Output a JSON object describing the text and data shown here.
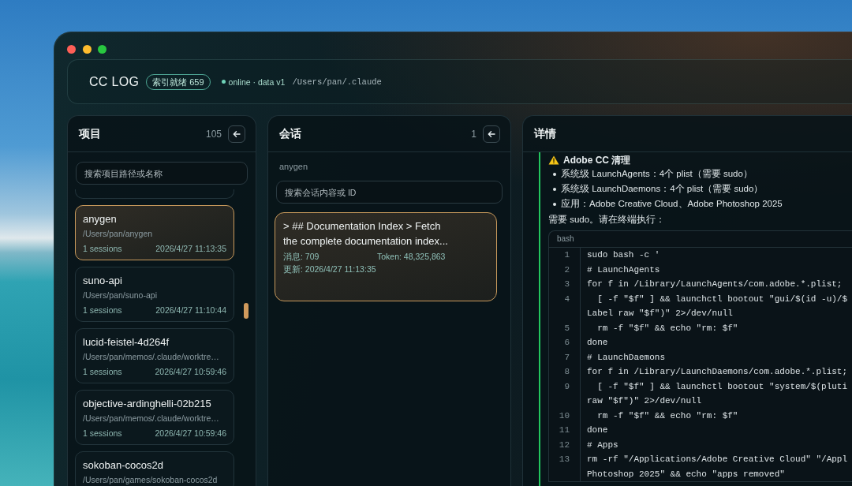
{
  "header": {
    "title": "CC LOG",
    "index_badge": "索引就绪 659",
    "status": "online · data v1",
    "path": "/Users/pan/.claude"
  },
  "projects_panel": {
    "title": "项目",
    "count": "105",
    "search": {
      "placeholder": "搜索项目路径或名称"
    },
    "items": [
      {
        "name": "anygen",
        "path": "/Users/pan/anygen",
        "sessions": "1 sessions",
        "updated": "2026/4/27 11:13:35",
        "selected": true
      },
      {
        "name": "suno-api",
        "path": "/Users/pan/suno-api",
        "sessions": "1 sessions",
        "updated": "2026/4/27 11:10:44",
        "selected": false
      },
      {
        "name": "lucid-feistel-4d264f",
        "path": "/Users/pan/memos/.claude/worktre…",
        "sessions": "1 sessions",
        "updated": "2026/4/27 10:59:46",
        "selected": false
      },
      {
        "name": "objective-ardinghelli-02b215",
        "path": "/Users/pan/memos/.claude/worktre…",
        "sessions": "1 sessions",
        "updated": "2026/4/27 10:59:46",
        "selected": false
      },
      {
        "name": "sokoban-cocos2d",
        "path": "/Users/pan/games/sokoban-cocos2d",
        "selected": false
      }
    ]
  },
  "sessions_panel": {
    "title": "会话",
    "count": "1",
    "project": "anygen",
    "search": {
      "placeholder": "搜索会话内容或 ID"
    },
    "items": [
      {
        "title": "> ## Documentation Index > Fetch the complete documentation index...",
        "messages": "消息: 709",
        "tokens": "Token: 48,325,863",
        "updated": "更新: 2026/4/27 11:13:35",
        "selected": true
      }
    ]
  },
  "details_panel": {
    "title": "详情",
    "message": {
      "heading": "Adobe CC 清理",
      "bullets": [
        "系统级 LaunchAgents：4个 plist（需要 sudo）",
        "系统级 LaunchDaemons：4个 plist（需要 sudo）",
        "应用：Adobe Creative Cloud、Adobe Photoshop 2025"
      ],
      "note": "需要 sudo。请在终端执行：",
      "code": {
        "language": "bash",
        "lines": [
          {
            "number": "1",
            "rows": [
              "sudo bash -c '"
            ]
          },
          {
            "number": "2",
            "rows": [
              "# LaunchAgents"
            ]
          },
          {
            "number": "3",
            "rows": [
              "for f in /Library/LaunchAgents/com.adobe.*.plist;"
            ]
          },
          {
            "number": "4",
            "rows": [
              "  [ -f \"$f\" ] && launchctl bootout \"gui/$(id -u)/$",
              "Label raw \"$f\")\" 2>/dev/null"
            ]
          },
          {
            "number": "5",
            "rows": [
              "  rm -f \"$f\" && echo \"rm: $f\""
            ]
          },
          {
            "number": "6",
            "rows": [
              "done"
            ]
          },
          {
            "number": "7",
            "rows": [
              "# LaunchDaemons"
            ]
          },
          {
            "number": "8",
            "rows": [
              "for f in /Library/LaunchDaemons/com.adobe.*.plist;"
            ]
          },
          {
            "number": "9",
            "rows": [
              "  [ -f \"$f\" ] && launchctl bootout \"system/$(pluti",
              "raw \"$f\")\" 2>/dev/null"
            ]
          },
          {
            "number": "10",
            "rows": [
              "  rm -f \"$f\" && echo \"rm: $f\""
            ]
          },
          {
            "number": "11",
            "rows": [
              "done"
            ]
          },
          {
            "number": "12",
            "rows": [
              "# Apps"
            ]
          },
          {
            "number": "13",
            "rows": [
              "rm -rf \"/Applications/Adobe Creative Cloud\" \"/Appl",
              "Photoshop 2025\" && echo \"apps removed\""
            ]
          }
        ]
      }
    }
  }
}
